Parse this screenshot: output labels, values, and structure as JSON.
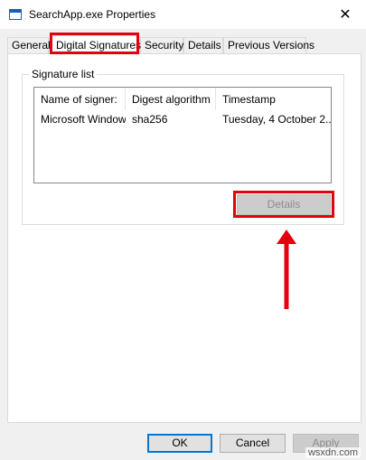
{
  "window": {
    "title": "SearchApp.exe Properties",
    "icon": "window-app-icon",
    "close_glyph": "✕"
  },
  "tabs": [
    {
      "label": "General",
      "active": false
    },
    {
      "label": "Digital Signatures",
      "active": true
    },
    {
      "label": "Security",
      "active": false
    },
    {
      "label": "Details",
      "active": false
    },
    {
      "label": "Previous Versions",
      "active": false
    }
  ],
  "signature_group": {
    "label": "Signature list",
    "columns": [
      "Name of signer:",
      "Digest algorithm",
      "Timestamp"
    ],
    "rows": [
      [
        "Microsoft Windows",
        "sha256",
        "Tuesday, 4 October 2..."
      ]
    ],
    "details_label": "Details",
    "details_enabled": false
  },
  "buttons": {
    "ok": "OK",
    "cancel": "Cancel",
    "apply": "Apply"
  },
  "annotations": {
    "highlight_color": "#e3000f"
  },
  "watermark": "wsxdn.com"
}
